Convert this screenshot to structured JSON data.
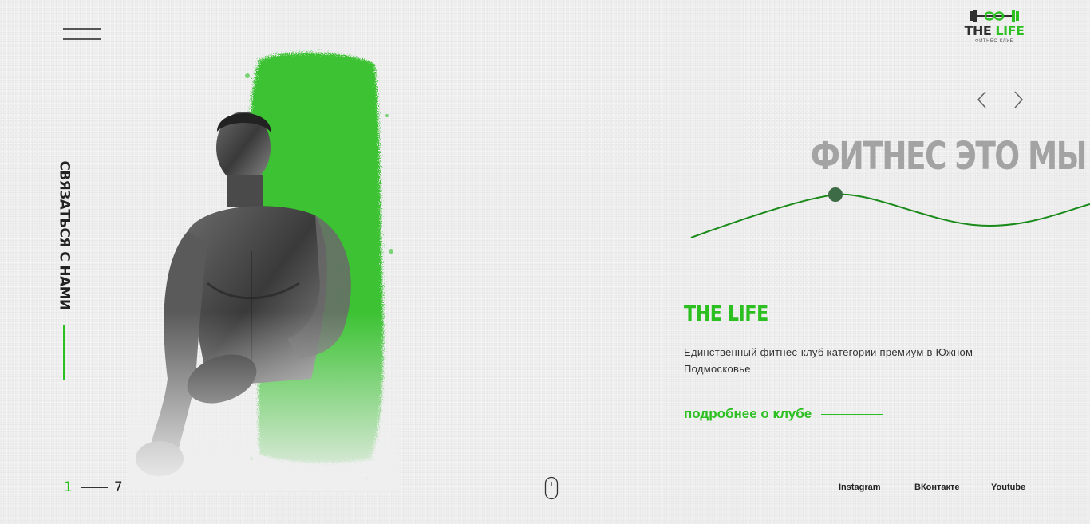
{
  "header": {
    "logo": {
      "name_part1": "THE",
      "name_part2": "LIFE",
      "subtitle": "ФИТНЕС-КЛУБ"
    }
  },
  "sidebar": {
    "contact_label": "СВЯЗАТЬСЯ С НАМИ"
  },
  "hero": {
    "headline": "ФИТНЕС ЭТО МЫ",
    "club_title": "THE LIFE",
    "club_description": "Единственный фитнес-клуб категории премиум в Южном Подмосковье",
    "more_link": "подробнее о клубе"
  },
  "pager": {
    "current": "1",
    "total": "7"
  },
  "socials": [
    {
      "label": "Instagram"
    },
    {
      "label": "ВКонтакте"
    },
    {
      "label": "Youtube"
    }
  ],
  "icons": {
    "menu": "hamburger-icon",
    "prev": "chevron-left-icon",
    "next": "chevron-right-icon",
    "scroll": "mouse-icon",
    "logo": "dumbbell-icon"
  },
  "colors": {
    "accent": "#2bbf20",
    "wave": "#1a8a1a",
    "dot": "#3d6b45",
    "headline": "#a3a3a3",
    "background": "#efefef"
  }
}
